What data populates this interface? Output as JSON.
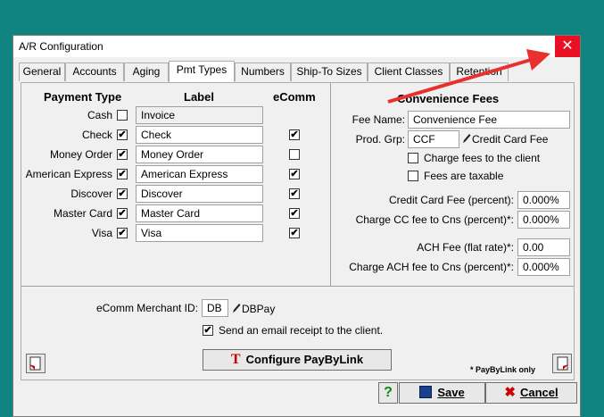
{
  "window": {
    "title": "A/R Configuration",
    "close_glyph": "✕"
  },
  "tabs": [
    "General",
    "Accounts",
    "Aging",
    "Pmt Types",
    "Numbers",
    "Ship-To Sizes",
    "Client Classes",
    "Retention"
  ],
  "active_tab": "Pmt Types",
  "payment_headers": {
    "type": "Payment Type",
    "label": "Label",
    "ecomm": "eComm"
  },
  "payment_rows": [
    {
      "type": "Cash",
      "enabled": false,
      "label": "Invoice",
      "ecomm": null
    },
    {
      "type": "Check",
      "enabled": true,
      "label": "Check",
      "ecomm": true
    },
    {
      "type": "Money Order",
      "enabled": true,
      "label": "Money Order",
      "ecomm": false
    },
    {
      "type": "American Express",
      "enabled": true,
      "label": "American Express",
      "ecomm": true
    },
    {
      "type": "Discover",
      "enabled": true,
      "label": "Discover",
      "ecomm": true
    },
    {
      "type": "Master Card",
      "enabled": true,
      "label": "Master Card",
      "ecomm": true
    },
    {
      "type": "Visa",
      "enabled": true,
      "label": "Visa",
      "ecomm": true
    }
  ],
  "fees": {
    "title": "Convenience Fees",
    "fee_name_label": "Fee Name:",
    "fee_name": "Convenience Fee",
    "prod_grp_label": "Prod. Grp:",
    "prod_grp": "CCF",
    "prod_grp_desc": "Credit Card Fee",
    "charge_fees_label": "Charge fees to the client",
    "charge_fees": false,
    "taxable_label": "Fees are taxable",
    "taxable": false,
    "cc_fee_label": "Credit Card Fee (percent):",
    "cc_fee": "0.000%",
    "charge_cc_label": "Charge CC fee to Cns (percent)*:",
    "charge_cc": "0.000%",
    "ach_fee_label": "ACH Fee (flat rate)*:",
    "ach_fee": "0.00",
    "charge_ach_label": "Charge ACH fee to Cns (percent)*:",
    "charge_ach": "0.000%"
  },
  "merchant": {
    "label": "eComm Merchant ID:",
    "id": "DB",
    "desc": "DBPay",
    "email_label": "Send an email receipt to the client.",
    "email_checked": true
  },
  "configure_button": "Configure PayByLink",
  "paybylink_note": "* PayByLink only",
  "buttons": {
    "help": "?",
    "save": "Save",
    "cancel": "Cancel"
  },
  "colors": {
    "arrow": "#e8312f",
    "close_bg": "#e81123",
    "desktop": "#0f8480"
  }
}
